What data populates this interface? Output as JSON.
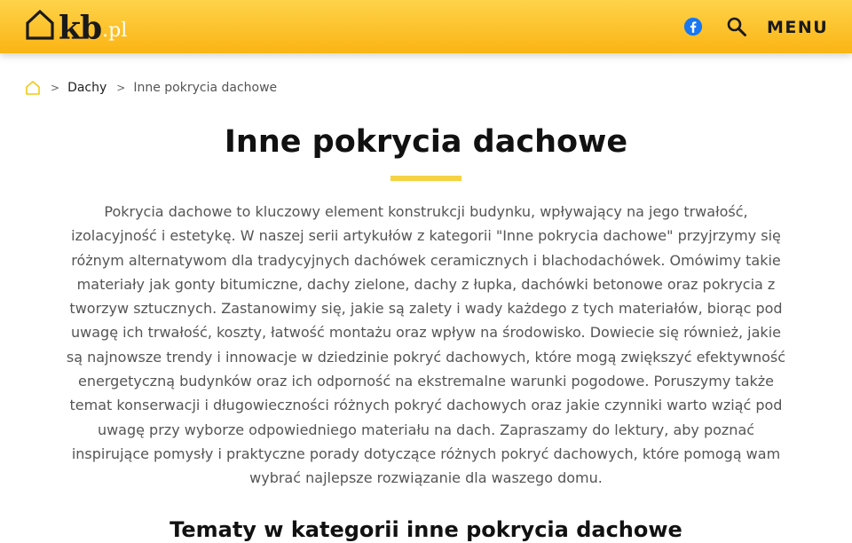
{
  "header": {
    "logo": {
      "main": "kb",
      "suffix": ".pl"
    },
    "icons": {
      "facebook": "facebook-icon",
      "search": "search-icon"
    },
    "menu_label": "MENU"
  },
  "breadcrumb": {
    "home_icon": "home-icon",
    "separator": ">",
    "items": [
      {
        "label": "Dachy"
      },
      {
        "label": "Inne pokrycia dachowe"
      }
    ]
  },
  "main": {
    "title": "Inne pokrycia dachowe",
    "intro": "Pokrycia dachowe to kluczowy element konstrukcji budynku, wpływający na jego trwałość, izolacyjność i estetykę. W naszej serii artykułów z kategorii \"Inne pokrycia dachowe\" przyjrzymy się różnym alternatywom dla tradycyjnych dachówek ceramicznych i blachodachówek. Omówimy takie materiały jak gonty bitumiczne, dachy zielone, dachy z łupka, dachówki betonowe oraz pokrycia z tworzyw sztucznych. Zastanowimy się, jakie są zalety i wady każdego z tych materiałów, biorąc pod uwagę ich trwałość, koszty, łatwość montażu oraz wpływ na środowisko. Dowiecie się również, jakie są najnowsze trendy i innowacje w dziedzinie pokryć dachowych, które mogą zwiększyć efektywność energetyczną budynków oraz ich odporność na ekstremalne warunki pogodowe. Poruszymy także temat konserwacji i długowieczności różnych pokryć dachowych oraz jakie czynniki warto wziąć pod uwagę przy wyborze odpowiedniego materiału na dach. Zapraszamy do lektury, aby poznać inspirujące pomysły i praktyczne porady dotyczące różnych pokryć dachowych, które pomogą wam wybrać najlepsze rozwiązanie dla waszego domu.",
    "section_title": "Tematy w kategorii inne pokrycia dachowe"
  },
  "colors": {
    "header_top": "#fed34a",
    "header_bottom": "#fbb414",
    "accent": "#f6d243",
    "facebook": "#1877f2"
  }
}
